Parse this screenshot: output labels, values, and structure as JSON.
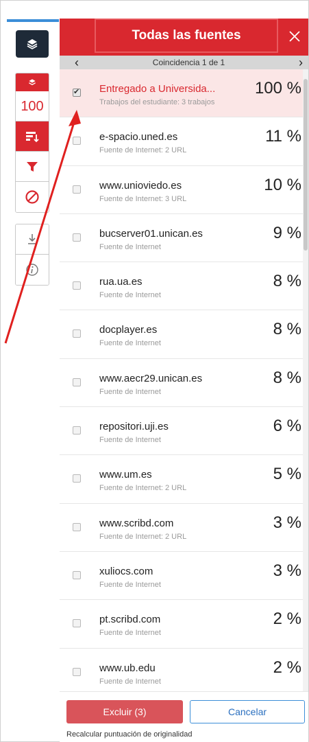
{
  "sidebar": {
    "score": "100",
    "icons": [
      "layers-icon",
      "sort-icon",
      "filter-icon",
      "exclude-icon",
      "download-icon",
      "info-icon"
    ]
  },
  "panel": {
    "title": "Todas las fuentes",
    "match_text": "Coincidencia 1 de 1"
  },
  "sources": [
    {
      "name": "Entregado a Universida...",
      "sub": "Trabajos del estudiante: 3 trabajos",
      "pct": "100 %",
      "checked": true
    },
    {
      "name": "e-spacio.uned.es",
      "sub": "Fuente de Internet: 2 URL",
      "pct": "11 %",
      "checked": false
    },
    {
      "name": "www.unioviedo.es",
      "sub": "Fuente de Internet: 3 URL",
      "pct": "10 %",
      "checked": false
    },
    {
      "name": "bucserver01.unican.es",
      "sub": "Fuente de Internet",
      "pct": "9 %",
      "checked": false
    },
    {
      "name": "rua.ua.es",
      "sub": "Fuente de Internet",
      "pct": "8 %",
      "checked": false
    },
    {
      "name": "docplayer.es",
      "sub": "Fuente de Internet",
      "pct": "8 %",
      "checked": false
    },
    {
      "name": "www.aecr29.unican.es",
      "sub": "Fuente de Internet",
      "pct": "8 %",
      "checked": false
    },
    {
      "name": "repositori.uji.es",
      "sub": "Fuente de Internet",
      "pct": "6 %",
      "checked": false
    },
    {
      "name": "www.um.es",
      "sub": "Fuente de Internet: 2 URL",
      "pct": "5 %",
      "checked": false
    },
    {
      "name": "www.scribd.com",
      "sub": "Fuente de Internet: 2 URL",
      "pct": "3 %",
      "checked": false
    },
    {
      "name": "xuliocs.com",
      "sub": "Fuente de Internet",
      "pct": "3 %",
      "checked": false
    },
    {
      "name": "pt.scribd.com",
      "sub": "Fuente de Internet",
      "pct": "2 %",
      "checked": false
    },
    {
      "name": "www.ub.edu",
      "sub": "Fuente de Internet",
      "pct": "2 %",
      "checked": false
    }
  ],
  "footer": {
    "exclude_label": "Excluir (3)",
    "cancel_label": "Cancelar",
    "recalc_text": "Recalcular puntuación de originalidad"
  },
  "colors": {
    "accent": "#d9282f",
    "dark": "#1e2a38",
    "link": "#3b8ed8"
  }
}
